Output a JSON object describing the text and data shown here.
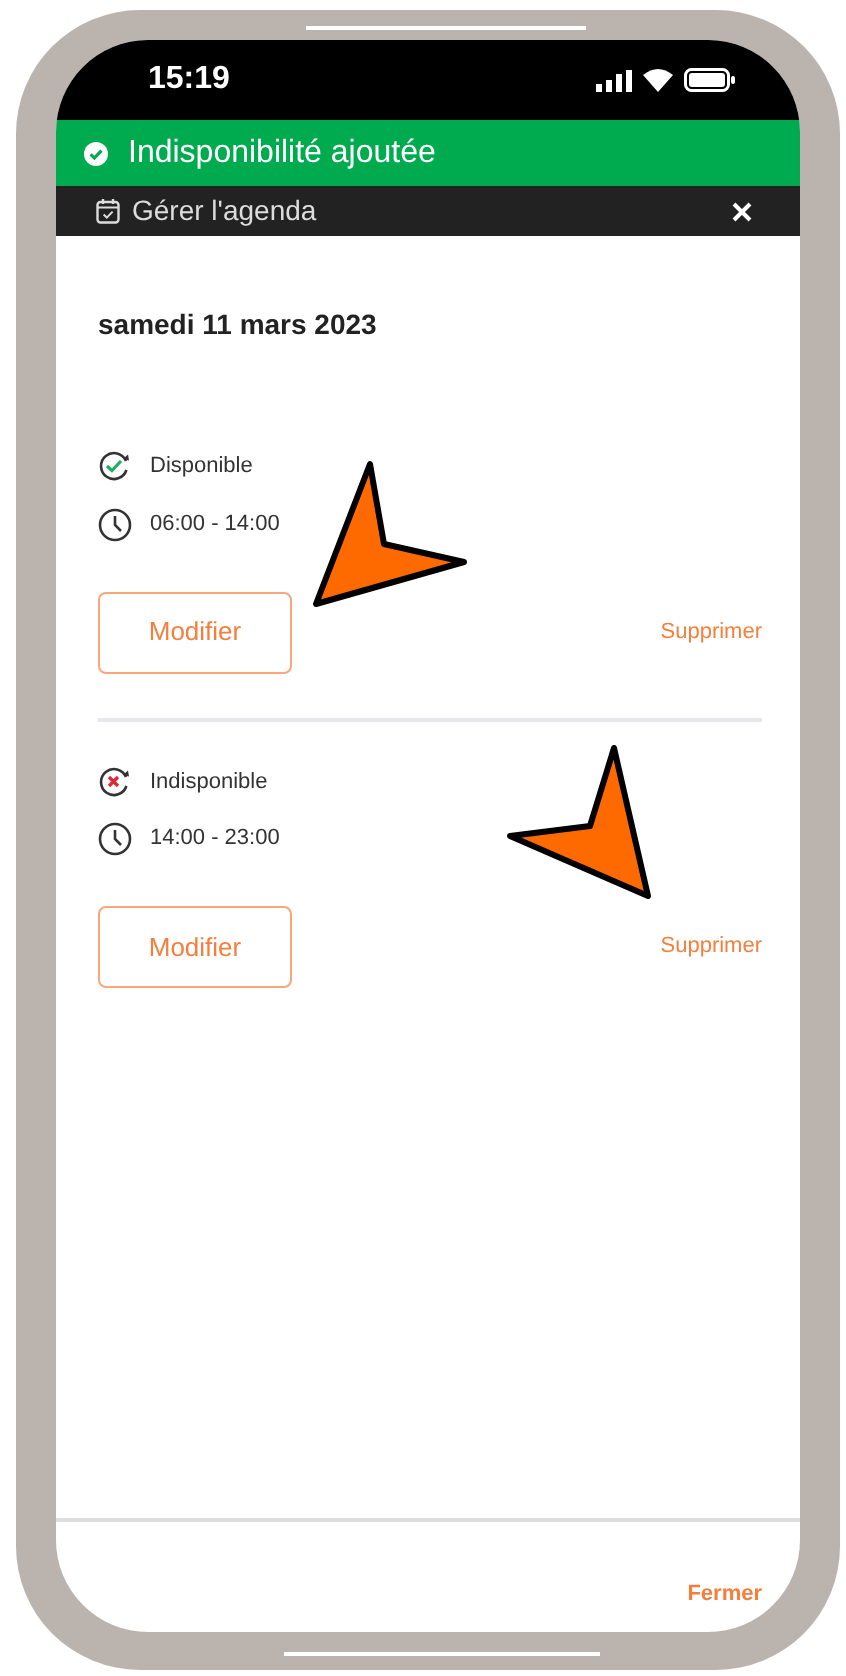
{
  "status_bar": {
    "time": "15:19"
  },
  "toast": {
    "text": "Indisponibilité ajoutée"
  },
  "header": {
    "title": "Gérer l'agenda"
  },
  "date": "samedi 11 mars 2023",
  "slots": [
    {
      "kind": "available",
      "status": "Disponible",
      "hours": "06:00 - 14:00",
      "edit": "Modifier",
      "delete": "Supprimer"
    },
    {
      "kind": "unavailable",
      "status": "Indisponible",
      "hours": "14:00 - 23:00",
      "edit": "Modifier",
      "delete": "Supprimer"
    }
  ],
  "footer": {
    "close": "Fermer"
  }
}
